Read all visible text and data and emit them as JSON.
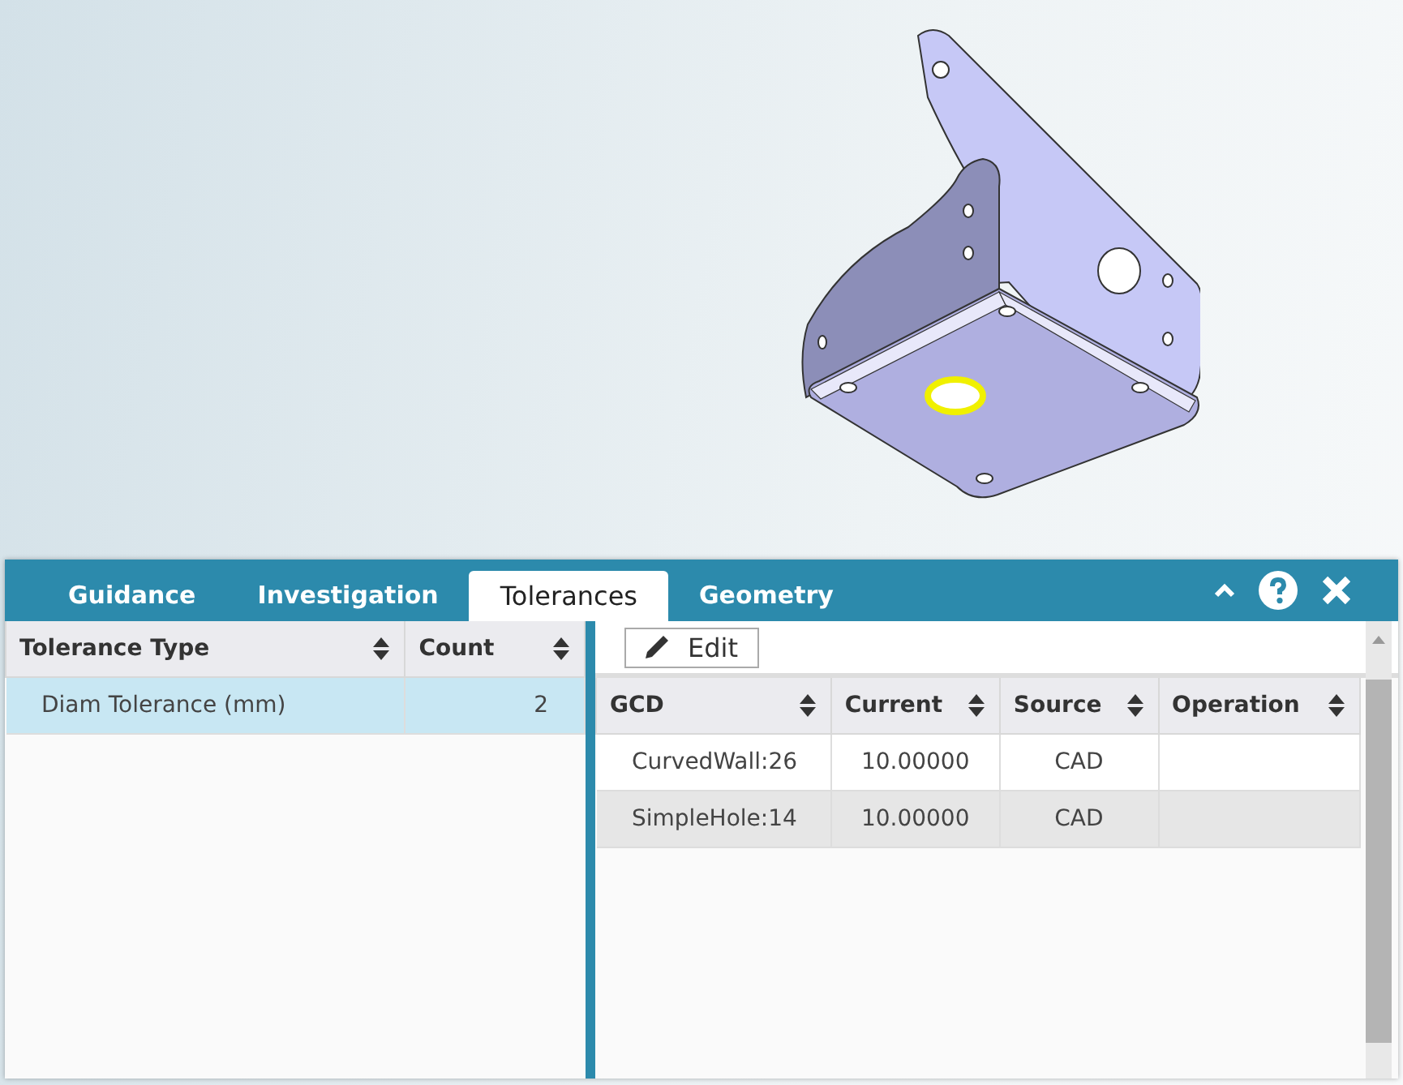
{
  "tabs": [
    {
      "label": "Guidance",
      "selected": false
    },
    {
      "label": "Investigation",
      "selected": false
    },
    {
      "label": "Tolerances",
      "selected": true
    },
    {
      "label": "Geometry",
      "selected": false
    }
  ],
  "tolerance_table": {
    "columns": [
      "Tolerance Type",
      "Count"
    ],
    "rows": [
      {
        "cells": [
          "Diam Tolerance (mm)",
          "2"
        ],
        "selected": true
      }
    ]
  },
  "toolbar": {
    "edit_button": "Edit"
  },
  "gcd_table": {
    "columns": [
      "GCD",
      "Current",
      "Source",
      "Operation"
    ],
    "rows": [
      {
        "cells": [
          "CurvedWall:26",
          "10.00000",
          "CAD",
          ""
        ],
        "selected": false
      },
      {
        "cells": [
          "SimpleHole:14",
          "10.00000",
          "CAD",
          ""
        ],
        "selected": true
      }
    ]
  }
}
